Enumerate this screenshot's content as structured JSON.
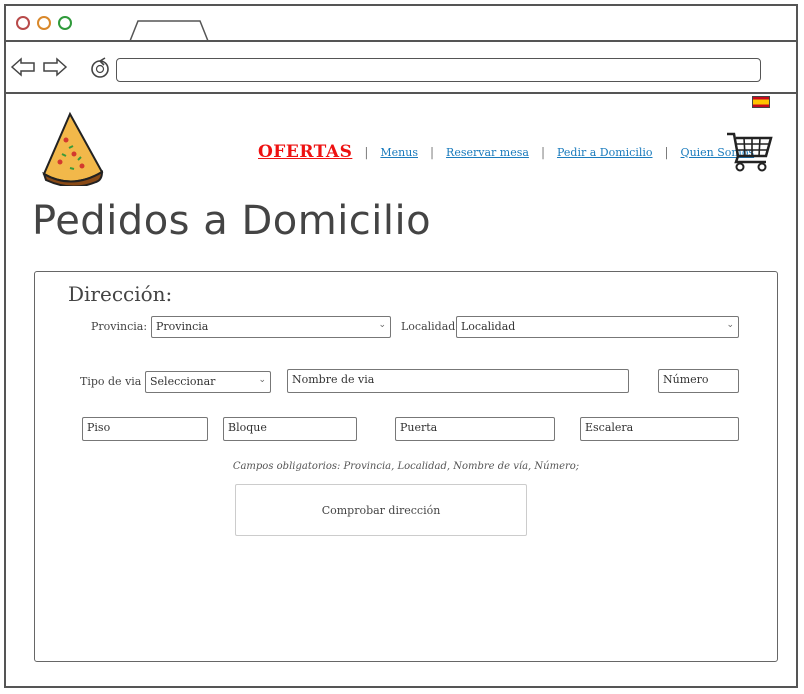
{
  "browser": {
    "url": ""
  },
  "nav": {
    "ofertas": "OFERTAS",
    "menus": "Menus",
    "reservar": "Reservar mesa",
    "pedir": "Pedir a Domicilio",
    "quien": "Quien Somos",
    "separator": "|"
  },
  "page": {
    "title": "Pedidos a Domicilio"
  },
  "form": {
    "section": "Dirección:",
    "provincia_label": "Provincia:",
    "provincia_value": "Provincia",
    "localidad_label": "Localidad:",
    "localidad_value": "Localidad",
    "tipo_via_label": "Tipo de via",
    "tipo_via_value": "Seleccionar",
    "nombre_via_placeholder": "Nombre de via",
    "numero_placeholder": "Número",
    "piso_placeholder": "Piso",
    "bloque_placeholder": "Bloque",
    "puerta_placeholder": "Puerta",
    "escalera_placeholder": "Escalera",
    "required_note": "Campos obligatorios: Provincia, Localidad, Nombre de vía, Número;",
    "check_button": "Comprobar dirección",
    "caret": "⌄"
  },
  "colors": {
    "ofertas": "#e11111",
    "link": "#1a7bbd"
  }
}
